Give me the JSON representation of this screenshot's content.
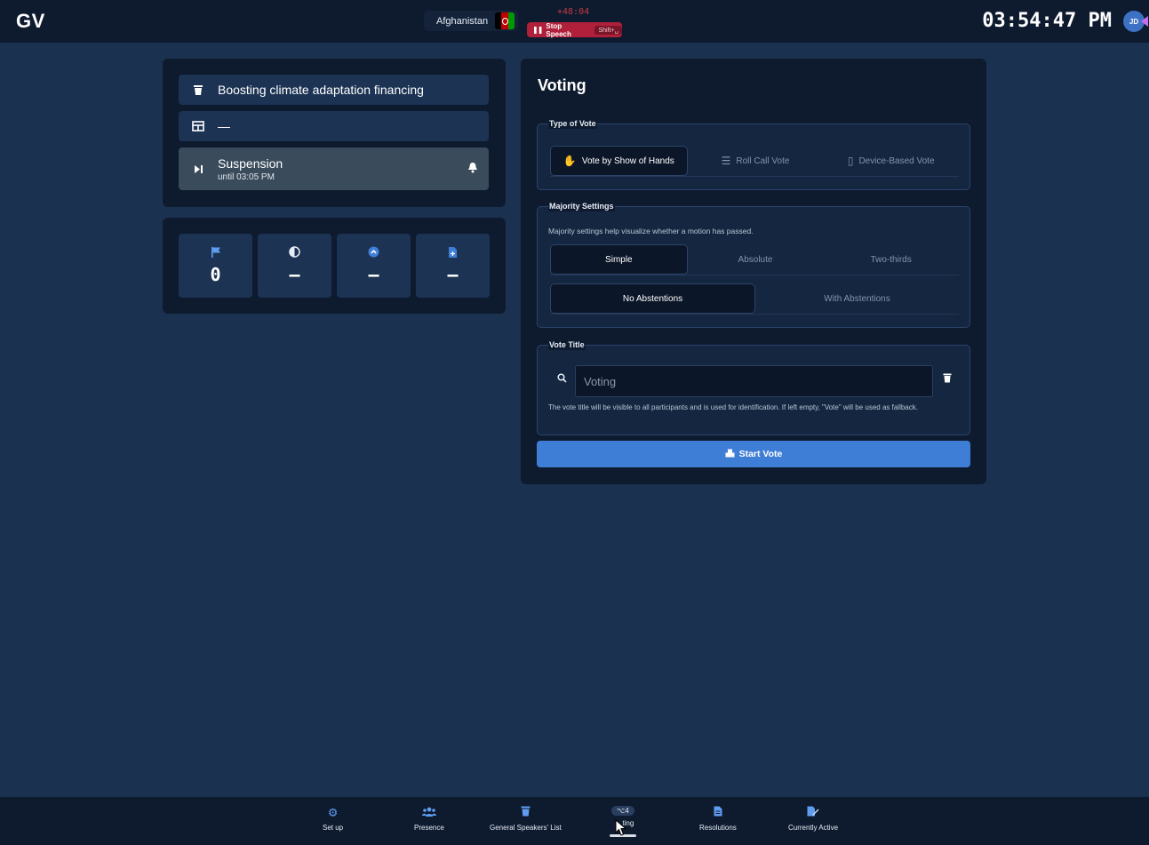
{
  "app": {
    "logo": "GV"
  },
  "header": {
    "country": "Afghanistan",
    "speech_timer": "+48:04",
    "stop_speech_label": "Stop Speech",
    "stop_speech_shortcut": "Shift+␣",
    "clock": "03:54:47 PM",
    "avatar_initials": "JD"
  },
  "info": {
    "topic": "Boosting climate adaptation financing",
    "secondary": "—",
    "suspension_title": "Suspension",
    "suspension_until": "until 03:05 PM"
  },
  "stats": [
    {
      "icon": "flag-icon",
      "value": "0"
    },
    {
      "icon": "contrast-icon",
      "value": "—"
    },
    {
      "icon": "chevron-up-circle-icon",
      "value": "—"
    },
    {
      "icon": "file-add-icon",
      "value": "—"
    }
  ],
  "voting": {
    "heading": "Voting",
    "type_legend": "Type of Vote",
    "types": [
      "Vote by Show of Hands",
      "Roll Call Vote",
      "Device-Based Vote"
    ],
    "majority_legend": "Majority Settings",
    "majority_desc": "Majority settings help visualize whether a motion has passed.",
    "majorities": [
      "Simple",
      "Absolute",
      "Two-thirds"
    ],
    "abstentions": [
      "No Abstentions",
      "With Abstentions"
    ],
    "title_legend": "Vote Title",
    "title_placeholder": "Voting",
    "title_hint": "The vote title will be visible to all participants and is used for identification. If left empty, \"Vote\" will be used as fallback.",
    "start_label": "Start Vote"
  },
  "nav": {
    "items": [
      "Set up",
      "Presence",
      "General Speakers' List",
      "ting",
      "Resolutions",
      "Currently Active"
    ],
    "badge": "⌥4"
  },
  "colors": {
    "background": "#1b3150",
    "panel": "#0e1a2e",
    "accent": "#3f7ed6",
    "stop_red": "#b0203a"
  }
}
